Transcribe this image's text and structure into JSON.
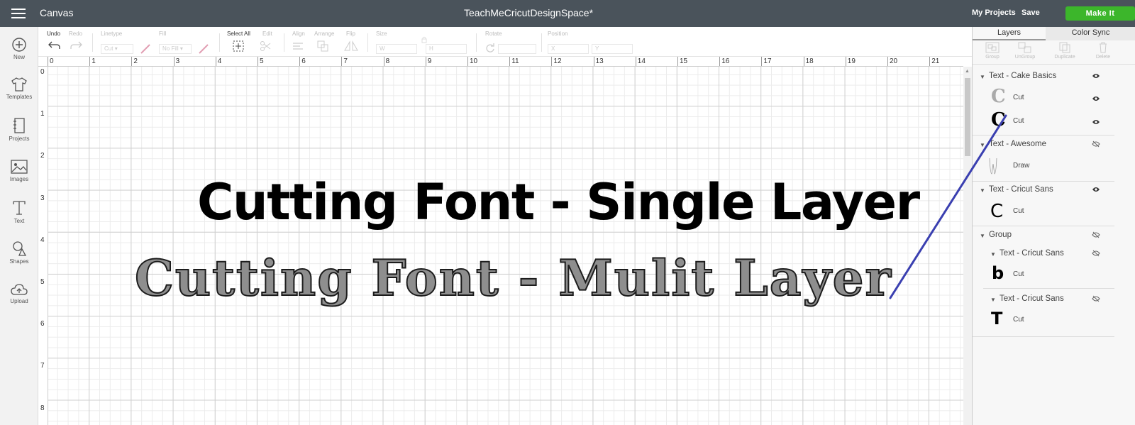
{
  "topbar": {
    "menu_icon": "hamburger-menu-icon",
    "app_title": "Canvas",
    "doc_title": "TeachMeCricutDesignSpace*",
    "my_projects": "My Projects",
    "save": "Save",
    "make_it": "Make It",
    "make_it_color": "#3cb62b",
    "bar_color": "#4a535b"
  },
  "leftbar": {
    "items": [
      {
        "label": "New",
        "icon": "plus-circle-icon"
      },
      {
        "label": "Templates",
        "icon": "tshirt-icon"
      },
      {
        "label": "Projects",
        "icon": "notebook-icon"
      },
      {
        "label": "Images",
        "icon": "image-icon"
      },
      {
        "label": "Text",
        "icon": "text-t-icon"
      },
      {
        "label": "Shapes",
        "icon": "shapes-icon"
      },
      {
        "label": "Upload",
        "icon": "cloud-upload-icon"
      }
    ]
  },
  "toolbar": {
    "undo": "Undo",
    "redo": "Redo",
    "linetype": "Linetype",
    "linetype_value": "Cut",
    "fill": "Fill",
    "fill_value": "No Fill",
    "select_all": "Select All",
    "edit": "Edit",
    "align": "Align",
    "arrange": "Arrange",
    "flip": "Flip",
    "size": "Size",
    "size_w": "W",
    "size_h": "H",
    "rotate": "Rotate",
    "position": "Position",
    "position_x": "X",
    "position_y": "Y"
  },
  "rulers": {
    "top": [
      "0",
      "1",
      "2",
      "3",
      "4",
      "5",
      "6",
      "7",
      "8",
      "9",
      "10",
      "11",
      "12",
      "13",
      "14",
      "15",
      "16",
      "17",
      "18",
      "19",
      "20",
      "21"
    ],
    "left": [
      "0",
      "1",
      "2",
      "3",
      "4",
      "5",
      "6",
      "7",
      "8"
    ]
  },
  "canvas": {
    "single_layer_text": "Cutting Font - Single Layer",
    "multi_layer_text": "Cutting Font - Mulit Layer",
    "annotation_line_color": "#3a3fb0"
  },
  "panel": {
    "tabs": {
      "layers": "Layers",
      "color_sync": "Color Sync"
    },
    "actions": {
      "group": "Group",
      "ungroup": "UnGroup",
      "duplicate": "Duplicate",
      "delete": "Delete"
    },
    "layers": [
      {
        "name": "Text - Cake Basics",
        "visible": true,
        "children": [
          {
            "thumb": "C",
            "op": "Cut",
            "visible": true
          },
          {
            "thumb": "C",
            "op": "Cut",
            "visible": true
          }
        ]
      },
      {
        "name": "Text - Awesome",
        "visible": false,
        "children": [
          {
            "thumb": "W",
            "op": "Draw"
          }
        ]
      },
      {
        "name": "Text - Cricut Sans",
        "visible": true,
        "children": [
          {
            "thumb": "C",
            "op": "Cut"
          }
        ]
      },
      {
        "name": "Group",
        "visible": false,
        "children": [
          {
            "name": "Text - Cricut Sans",
            "visible": false,
            "thumb": "b",
            "op": "Cut"
          },
          {
            "name": "Text - Cricut Sans",
            "visible": false,
            "thumb": "T",
            "op": "Cut"
          }
        ]
      }
    ]
  }
}
